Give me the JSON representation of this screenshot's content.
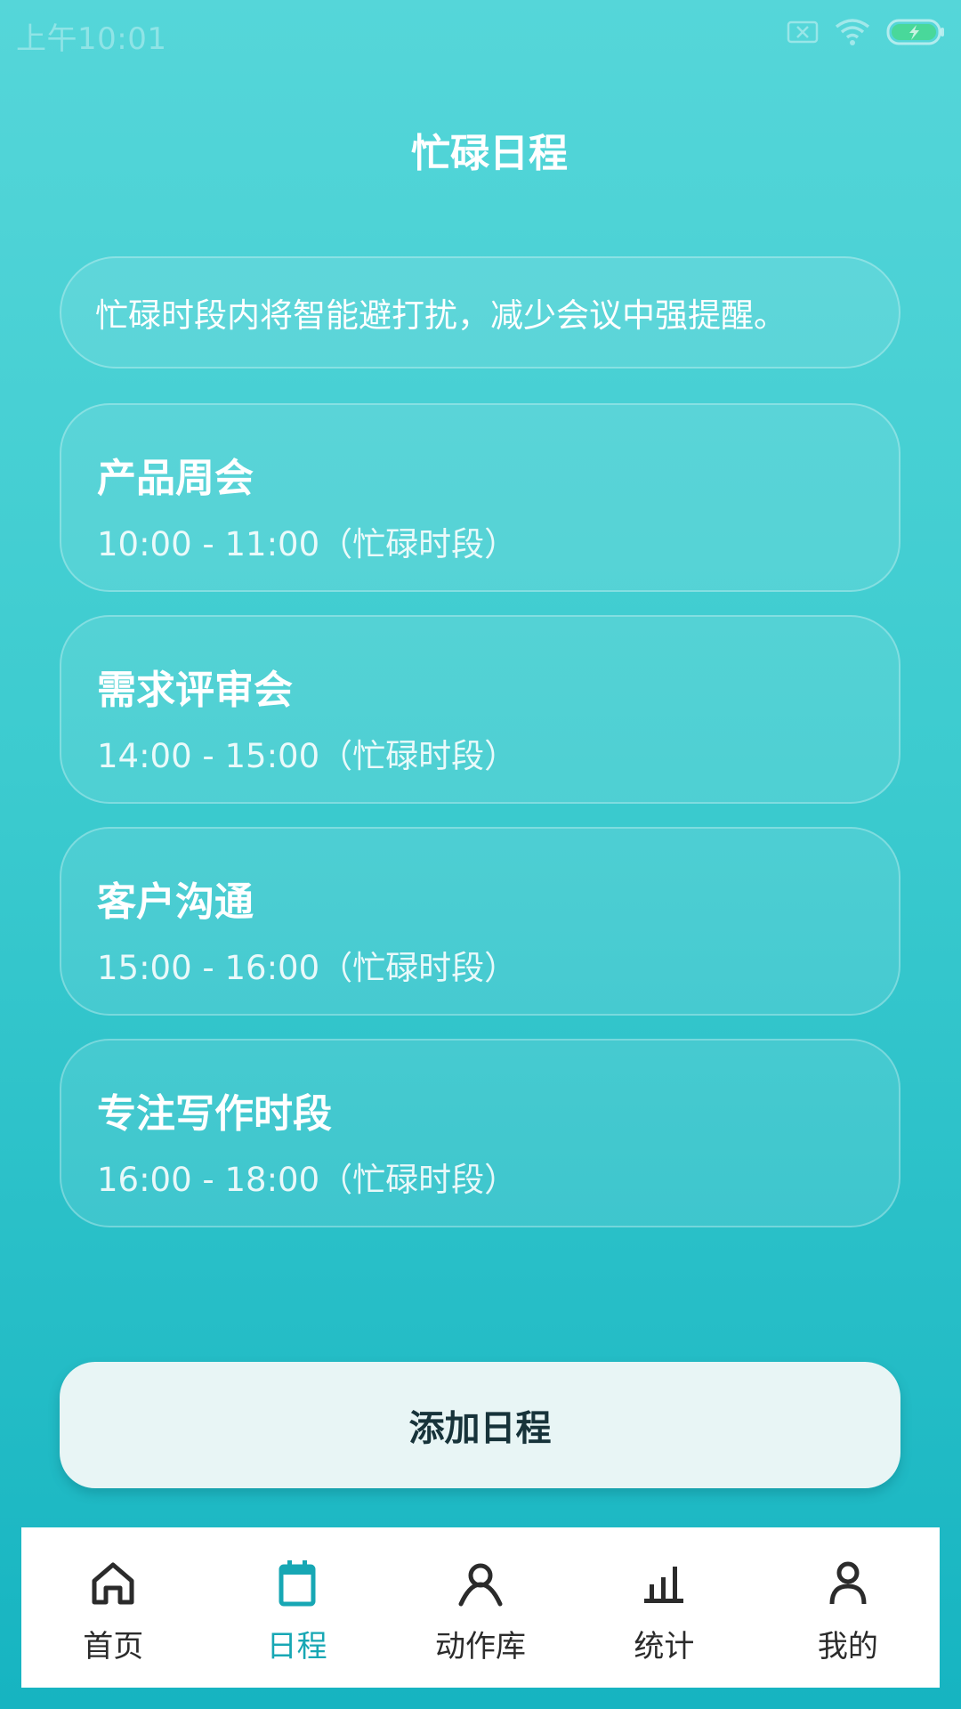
{
  "status_bar": {
    "time": "上午10:01"
  },
  "page": {
    "title": "忙碌日程"
  },
  "info": {
    "text": "忙碌时段内将智能避打扰，减少会议中强提醒。"
  },
  "schedules": [
    {
      "title": "产品周会",
      "time": "10:00 - 11:00（忙碌时段）"
    },
    {
      "title": "需求评审会",
      "time": "14:00 - 15:00（忙碌时段）"
    },
    {
      "title": "客户沟通",
      "time": "15:00 - 16:00（忙碌时段）"
    },
    {
      "title": "专注写作时段",
      "time": "16:00 - 18:00（忙碌时段）"
    }
  ],
  "actions": {
    "add_label": "添加日程"
  },
  "nav": {
    "items": [
      {
        "label": "首页",
        "icon": "home-icon",
        "active": false
      },
      {
        "label": "日程",
        "icon": "calendar-icon",
        "active": true
      },
      {
        "label": "动作库",
        "icon": "person-action-icon",
        "active": false
      },
      {
        "label": "统计",
        "icon": "bar-chart-icon",
        "active": false
      },
      {
        "label": "我的",
        "icon": "profile-icon",
        "active": false
      }
    ]
  },
  "colors": {
    "accent": "#17a7b4",
    "background_top": "#55d6d9",
    "background_bottom": "#16b4c1",
    "button_bg": "#e8f5f5"
  }
}
